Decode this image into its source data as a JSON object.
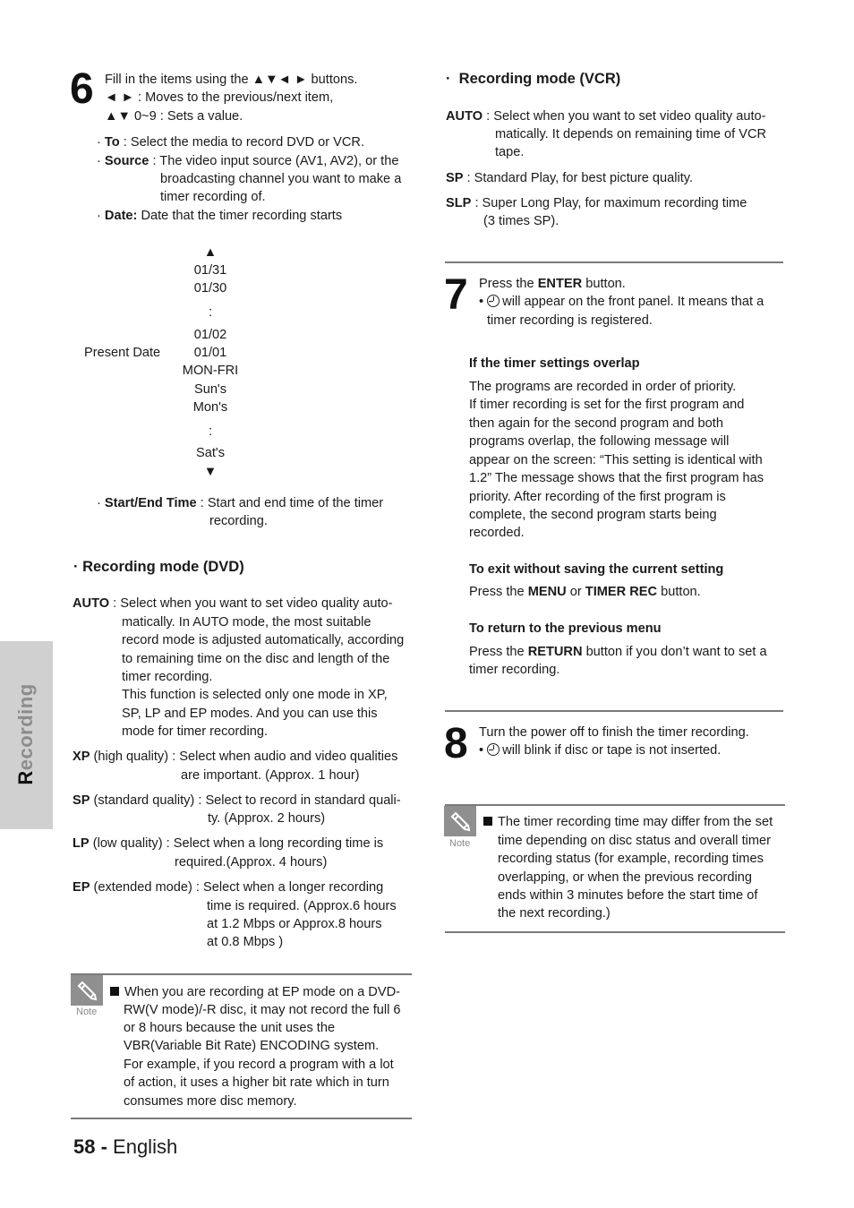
{
  "side_tab": {
    "first_letter": "R",
    "rest": "ecording"
  },
  "step6": {
    "number": "6",
    "intro": [
      "Fill in the items using the ▲▼◄ ► buttons.",
      "◄ ► : Moves to the previous/next item,",
      "▲▼ 0~9 : Sets a value."
    ],
    "to": {
      "label": "To",
      "text": " : Select the media to record DVD or VCR."
    },
    "source": {
      "label": "Source",
      "lines": [
        " : The video input source (AV1, AV2), or the",
        "broadcasting channel you want to make a",
        "timer recording of."
      ]
    },
    "date": {
      "label": "Date:",
      "text": " Date that the timer recording starts"
    },
    "date_list": {
      "up_arrow": "▲",
      "items": [
        "01/31",
        "01/30",
        ":",
        "01/02",
        "01/01",
        "MON-FRI",
        "Sun's",
        "Mon's",
        ":",
        "Sat's"
      ],
      "down_arrow": "▼",
      "present_label": "Present Date"
    },
    "start_end": {
      "label": "Start/End Time",
      "lines": [
        " : Start and end time of the timer",
        "recording."
      ]
    }
  },
  "dvd_modes": {
    "heading": "Recording mode (DVD)",
    "auto": {
      "label": "AUTO",
      "lines": [
        " : Select when you want to set video quality auto-",
        "matically. In AUTO mode, the most suitable",
        "record mode is adjusted automatically, according",
        "to remaining time on the disc and length of the",
        "timer recording.",
        "This function is selected only one mode in XP,",
        "SP, LP and EP modes.  And you can use this",
        "mode for timer recording."
      ]
    },
    "xp": {
      "label": "XP",
      "lines": [
        " (high quality) : Select when audio and video qualities",
        "are important. (Approx. 1 hour)"
      ]
    },
    "sp": {
      "label": "SP",
      "lines": [
        " (standard quality) : Select to record in standard quali-",
        "ty. (Approx. 2 hours)"
      ]
    },
    "lp": {
      "label": "LP",
      "lines": [
        " (low quality) : Select when a long recording time is",
        "required.(Approx. 4 hours)"
      ]
    },
    "ep": {
      "label": "EP",
      "lines": [
        " (extended mode) : Select when a longer recording",
        "time is required. (Approx.6 hours",
        "at 1.2 Mbps or Approx.8 hours",
        "at 0.8 Mbps )"
      ]
    }
  },
  "note_left": {
    "label": "Note",
    "lines": [
      "When you are recording at EP mode on a DVD-",
      "RW(V mode)/-R disc, it may not record the full 6",
      "or 8 hours because the unit uses the",
      "VBR(Variable Bit Rate) ENCODING system.",
      "For example, if you record a program with a lot",
      "of action, it uses a higher bit rate which in turn",
      "consumes more disc memory."
    ]
  },
  "vcr_modes": {
    "heading": "Recording mode (VCR)",
    "auto": {
      "label": "AUTO",
      "lines": [
        " : Select when you want to set video quality auto-",
        "matically. It depends on remaining time of VCR",
        "tape."
      ]
    },
    "sp": {
      "label": "SP",
      "text": " : Standard Play, for best picture quality."
    },
    "slp": {
      "label": "SLP",
      "lines": [
        " : Super Long Play, for maximum recording time",
        "(3 times SP)."
      ]
    }
  },
  "step7": {
    "number": "7",
    "line1_pre": "Press the ",
    "line1_bold": "ENTER",
    "line1_post": " button.",
    "bullet_line1": "will appear on the front panel. It means that a",
    "bullet_line2": "timer recording is registered.",
    "overlap": {
      "heading": "If the timer settings overlap",
      "lines": [
        "The programs are recorded in order of priority.",
        "If timer recording is set for the first program and",
        "then again for the second program and both",
        "programs overlap, the following message will",
        "appear on the screen: “This setting is identical with",
        "1.2” The message shows that the first program has",
        "priority. After recording of the first program is",
        "complete, the second program starts being",
        "recorded."
      ]
    },
    "exit": {
      "heading": "To exit without saving the current setting",
      "pre": "Press the ",
      "b1": "MENU",
      "mid": " or ",
      "b2": "TIMER REC",
      "post": " button."
    },
    "return": {
      "heading": "To return to the previous menu",
      "pre": "Press the ",
      "b1": "RETURN",
      "post": " button if you don’t want to set a",
      "line2": "timer recording."
    }
  },
  "step8": {
    "number": "8",
    "line1": "Turn the power off to finish the timer recording.",
    "bullet": "will blink if disc or tape is not inserted."
  },
  "note_right": {
    "label": "Note",
    "lines": [
      "The timer recording time may differ from the set",
      "time depending on disc status and overall timer",
      "recording status (for example, recording times",
      "overlapping, or when the previous recording",
      "ends within 3 minutes before the start time of",
      "the next recording.)"
    ]
  },
  "footer": {
    "page": "58 -",
    "lang": " English"
  }
}
